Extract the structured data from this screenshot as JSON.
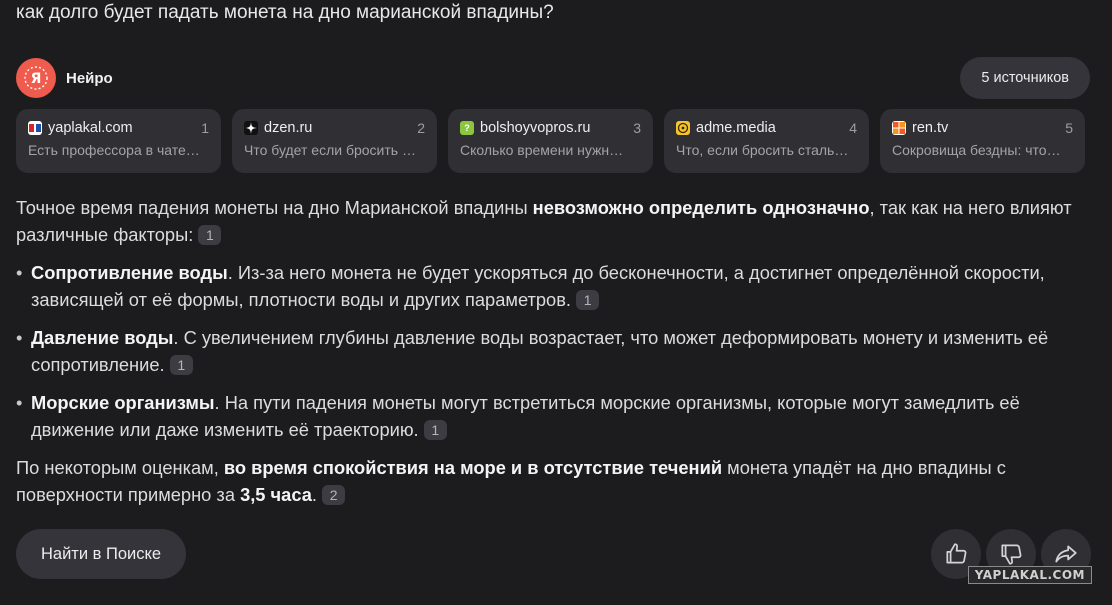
{
  "question": "как долго будет падать монета на дно марианской впадины?",
  "brand": {
    "name": "Нейро",
    "color": "#ef5b4c"
  },
  "sources_button": "5 источников",
  "sources": [
    {
      "domain": "yaplakal.com",
      "num": "1",
      "snippet": "Есть профессора в чате…",
      "icon": "yaplakal-favicon"
    },
    {
      "domain": "dzen.ru",
      "num": "2",
      "snippet": "Что будет если бросить …",
      "icon": "dzen-favicon"
    },
    {
      "domain": "bolshoyvopros.ru",
      "num": "3",
      "snippet": "Сколько времени нужн…",
      "icon": "bolshoyvopros-favicon"
    },
    {
      "domain": "adme.media",
      "num": "4",
      "snippet": "Что, если бросить сталь…",
      "icon": "adme-favicon"
    },
    {
      "domain": "ren.tv",
      "num": "5",
      "snippet": "Сокровища бездны: что…",
      "icon": "rentv-favicon"
    }
  ],
  "answer": {
    "intro_a": "Точное время падения монеты на дно Марианской впадины ",
    "intro_b": "невозможно определить однозначно",
    "intro_c": ", так как на него влияют различные факторы:",
    "intro_cite": "1",
    "bullets": [
      {
        "title": "Сопротивление воды",
        "text": ". Из-за него монета не будет ускоряться до бесконечности, а достигнет определённой скорости, зависящей от её формы, плотности воды и других параметров.",
        "cite": "1"
      },
      {
        "title": "Давление воды",
        "text": ". С увеличением глубины давление воды возрастает, что может деформировать монету и изменить её сопротивление.",
        "cite": "1"
      },
      {
        "title": "Морские организмы",
        "text": ". На пути падения монеты могут встретиться морские организмы, которые могут замедлить её движение или даже изменить её траекторию.",
        "cite": "1"
      }
    ],
    "outro_a": "По некоторым оценкам, ",
    "outro_b": "во время спокойствия на море и в отсутствие течений",
    "outro_c": " монета упадёт на дно впадины с поверхности примерно за ",
    "outro_d": "3,5 часа",
    "outro_e": ".",
    "outro_cite": "2"
  },
  "search_button": "Найти в Поиске",
  "actions": [
    "thumbs-up-icon",
    "thumbs-down-icon",
    "share-icon"
  ],
  "watermark": "YAPLAKAL.COM"
}
